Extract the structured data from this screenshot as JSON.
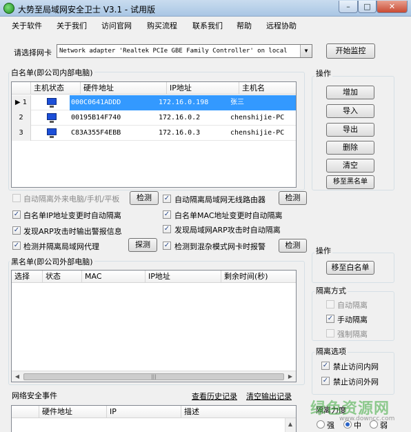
{
  "window": {
    "title": "大势至局域网安全卫士 V3.1 - 试用版",
    "min": "–",
    "max": "□",
    "close": "✕"
  },
  "menu": [
    "关于软件",
    "关于我们",
    "访问官网",
    "购买流程",
    "联系我们",
    "帮助",
    "远程协助"
  ],
  "nic": {
    "label": "请选择网卡",
    "selected": "Network adapter 'Realtek PCIe GBE Family Controller' on local",
    "start_button": "开始监控"
  },
  "whitelist": {
    "title": "白名单(即公司内部电脑)",
    "columns": [
      "主机状态",
      "硬件地址",
      "IP地址",
      "主机名"
    ],
    "rows": [
      {
        "num": "1",
        "mac": "000C0641ADDD",
        "ip": "172.16.0.198",
        "host": "张三",
        "selected": true
      },
      {
        "num": "2",
        "mac": "00195B14F740",
        "ip": "172.16.0.2",
        "host": "chenshijie-PC",
        "selected": false
      },
      {
        "num": "3",
        "mac": "C83A355F4EBB",
        "ip": "172.16.0.3",
        "host": "chenshijie-PC",
        "selected": false
      }
    ]
  },
  "operations": {
    "title": "操作",
    "buttons": [
      "增加",
      "导入",
      "导出",
      "删除",
      "清空",
      "移至黑名单"
    ]
  },
  "options": [
    {
      "label": "自动隔离外来电脑/手机/平板",
      "checked": false,
      "disabled": true,
      "button": "检测"
    },
    {
      "label": "自动隔离局域网无线路由器",
      "checked": true,
      "disabled": false,
      "button": "检测"
    },
    {
      "label": "白名单IP地址变更时自动隔离",
      "checked": true,
      "disabled": false,
      "button": ""
    },
    {
      "label": "白名单MAC地址变更时自动隔离",
      "checked": true,
      "disabled": false,
      "button": ""
    },
    {
      "label": "发现ARP攻击时输出警报信息",
      "checked": true,
      "disabled": false,
      "button": ""
    },
    {
      "label": "发现局域网ARP攻击时自动隔离",
      "checked": true,
      "disabled": false,
      "button": ""
    },
    {
      "label": "检测并隔离局域网代理",
      "checked": true,
      "disabled": false,
      "button": "探测"
    },
    {
      "label": "检测到混杂模式网卡时报警",
      "checked": true,
      "disabled": false,
      "button": "检测"
    }
  ],
  "blacklist": {
    "title": "黑名单(即公司外部电脑)",
    "columns": [
      "选择",
      "状态",
      "MAC",
      "IP地址",
      "剩余时间(秒)"
    ]
  },
  "operations2": {
    "title": "操作",
    "button": "移至白名单"
  },
  "isolation_mode": {
    "title": "隔离方式",
    "options": [
      {
        "label": "自动隔离",
        "checked": false,
        "disabled": true
      },
      {
        "label": "手动隔离",
        "checked": true,
        "disabled": false
      },
      {
        "label": "强制隔离",
        "checked": false,
        "disabled": true
      }
    ]
  },
  "isolation_options": {
    "title": "隔离选项",
    "options": [
      {
        "label": "禁止访问内网",
        "checked": true
      },
      {
        "label": "禁止访问外网",
        "checked": true
      }
    ]
  },
  "events": {
    "title": "网络安全事件",
    "history_link": "查看历史记录",
    "clear_link": "清空输出记录",
    "columns": [
      "硬件地址",
      "IP",
      "描述"
    ]
  },
  "strength": {
    "title": "隔离力度",
    "options": [
      {
        "label": "强",
        "on": false
      },
      {
        "label": "中",
        "on": true
      },
      {
        "label": "弱",
        "on": false
      }
    ]
  },
  "watermark": {
    "main": "绿色资源网",
    "sub": "www.downcc.com"
  },
  "colors": {
    "selection": "#3399ff",
    "title_bar": "#b8d0ea"
  }
}
